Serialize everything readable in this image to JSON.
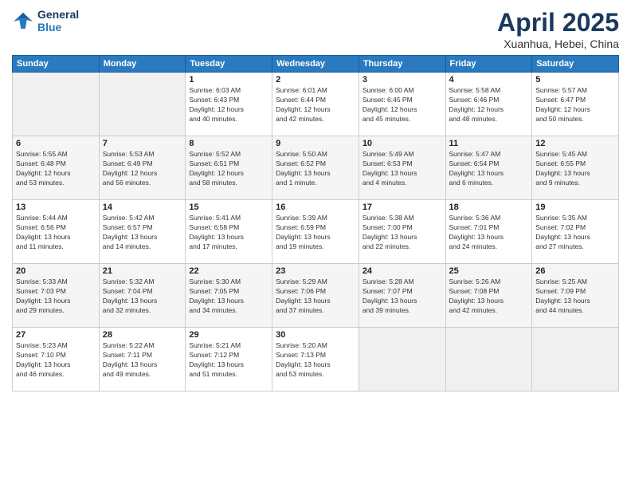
{
  "header": {
    "logo_line1": "General",
    "logo_line2": "Blue",
    "title": "April 2025",
    "location": "Xuanhua, Hebei, China"
  },
  "calendar": {
    "days_of_week": [
      "Sunday",
      "Monday",
      "Tuesday",
      "Wednesday",
      "Thursday",
      "Friday",
      "Saturday"
    ],
    "weeks": [
      [
        {
          "day": "",
          "info": ""
        },
        {
          "day": "",
          "info": ""
        },
        {
          "day": "1",
          "info": "Sunrise: 6:03 AM\nSunset: 6:43 PM\nDaylight: 12 hours\nand 40 minutes."
        },
        {
          "day": "2",
          "info": "Sunrise: 6:01 AM\nSunset: 6:44 PM\nDaylight: 12 hours\nand 42 minutes."
        },
        {
          "day": "3",
          "info": "Sunrise: 6:00 AM\nSunset: 6:45 PM\nDaylight: 12 hours\nand 45 minutes."
        },
        {
          "day": "4",
          "info": "Sunrise: 5:58 AM\nSunset: 6:46 PM\nDaylight: 12 hours\nand 48 minutes."
        },
        {
          "day": "5",
          "info": "Sunrise: 5:57 AM\nSunset: 6:47 PM\nDaylight: 12 hours\nand 50 minutes."
        }
      ],
      [
        {
          "day": "6",
          "info": "Sunrise: 5:55 AM\nSunset: 6:48 PM\nDaylight: 12 hours\nand 53 minutes."
        },
        {
          "day": "7",
          "info": "Sunrise: 5:53 AM\nSunset: 6:49 PM\nDaylight: 12 hours\nand 56 minutes."
        },
        {
          "day": "8",
          "info": "Sunrise: 5:52 AM\nSunset: 6:51 PM\nDaylight: 12 hours\nand 58 minutes."
        },
        {
          "day": "9",
          "info": "Sunrise: 5:50 AM\nSunset: 6:52 PM\nDaylight: 13 hours\nand 1 minute."
        },
        {
          "day": "10",
          "info": "Sunrise: 5:49 AM\nSunset: 6:53 PM\nDaylight: 13 hours\nand 4 minutes."
        },
        {
          "day": "11",
          "info": "Sunrise: 5:47 AM\nSunset: 6:54 PM\nDaylight: 13 hours\nand 6 minutes."
        },
        {
          "day": "12",
          "info": "Sunrise: 5:45 AM\nSunset: 6:55 PM\nDaylight: 13 hours\nand 9 minutes."
        }
      ],
      [
        {
          "day": "13",
          "info": "Sunrise: 5:44 AM\nSunset: 6:56 PM\nDaylight: 13 hours\nand 11 minutes."
        },
        {
          "day": "14",
          "info": "Sunrise: 5:42 AM\nSunset: 6:57 PM\nDaylight: 13 hours\nand 14 minutes."
        },
        {
          "day": "15",
          "info": "Sunrise: 5:41 AM\nSunset: 6:58 PM\nDaylight: 13 hours\nand 17 minutes."
        },
        {
          "day": "16",
          "info": "Sunrise: 5:39 AM\nSunset: 6:59 PM\nDaylight: 13 hours\nand 19 minutes."
        },
        {
          "day": "17",
          "info": "Sunrise: 5:38 AM\nSunset: 7:00 PM\nDaylight: 13 hours\nand 22 minutes."
        },
        {
          "day": "18",
          "info": "Sunrise: 5:36 AM\nSunset: 7:01 PM\nDaylight: 13 hours\nand 24 minutes."
        },
        {
          "day": "19",
          "info": "Sunrise: 5:35 AM\nSunset: 7:02 PM\nDaylight: 13 hours\nand 27 minutes."
        }
      ],
      [
        {
          "day": "20",
          "info": "Sunrise: 5:33 AM\nSunset: 7:03 PM\nDaylight: 13 hours\nand 29 minutes."
        },
        {
          "day": "21",
          "info": "Sunrise: 5:32 AM\nSunset: 7:04 PM\nDaylight: 13 hours\nand 32 minutes."
        },
        {
          "day": "22",
          "info": "Sunrise: 5:30 AM\nSunset: 7:05 PM\nDaylight: 13 hours\nand 34 minutes."
        },
        {
          "day": "23",
          "info": "Sunrise: 5:29 AM\nSunset: 7:06 PM\nDaylight: 13 hours\nand 37 minutes."
        },
        {
          "day": "24",
          "info": "Sunrise: 5:28 AM\nSunset: 7:07 PM\nDaylight: 13 hours\nand 39 minutes."
        },
        {
          "day": "25",
          "info": "Sunrise: 5:26 AM\nSunset: 7:08 PM\nDaylight: 13 hours\nand 42 minutes."
        },
        {
          "day": "26",
          "info": "Sunrise: 5:25 AM\nSunset: 7:09 PM\nDaylight: 13 hours\nand 44 minutes."
        }
      ],
      [
        {
          "day": "27",
          "info": "Sunrise: 5:23 AM\nSunset: 7:10 PM\nDaylight: 13 hours\nand 46 minutes."
        },
        {
          "day": "28",
          "info": "Sunrise: 5:22 AM\nSunset: 7:11 PM\nDaylight: 13 hours\nand 49 minutes."
        },
        {
          "day": "29",
          "info": "Sunrise: 5:21 AM\nSunset: 7:12 PM\nDaylight: 13 hours\nand 51 minutes."
        },
        {
          "day": "30",
          "info": "Sunrise: 5:20 AM\nSunset: 7:13 PM\nDaylight: 13 hours\nand 53 minutes."
        },
        {
          "day": "",
          "info": ""
        },
        {
          "day": "",
          "info": ""
        },
        {
          "day": "",
          "info": ""
        }
      ]
    ]
  }
}
